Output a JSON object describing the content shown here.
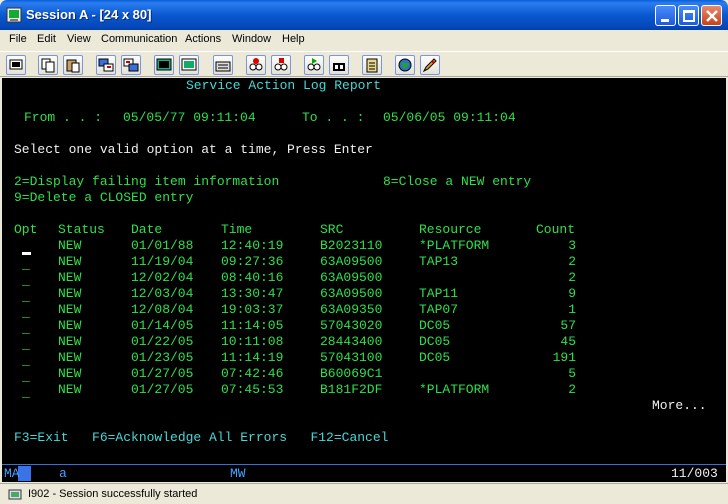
{
  "window": {
    "title": "Session A - [24 x 80]"
  },
  "menubar": [
    "File",
    "Edit",
    "View",
    "Communication",
    "Actions",
    "Window",
    "Help"
  ],
  "toolbar": {
    "buttons": [
      "print-screen-icon",
      "copy-icon",
      "paste-icon",
      "send-icon",
      "receive-icon",
      "display-icon",
      "keypad-icon",
      "macro-icon",
      "record-macro-icon",
      "stop-macro-icon",
      "play-macro-icon",
      "run-macro-icon",
      "clipboard-icon",
      "globe-icon",
      "edit-icon"
    ]
  },
  "screen": {
    "title": "Service Action Log Report",
    "from_label": "From . . :",
    "from_value": "05/05/77 09:11:04",
    "to_label": "To . . :",
    "to_value": "05/06/05 09:11:04",
    "instruction": "Select one valid option at a time, Press Enter",
    "option_2": "2=Display failing item information",
    "option_8": "8=Close a NEW entry",
    "option_9": "9=Delete a CLOSED entry",
    "columns": [
      "Opt",
      "Status",
      "Date",
      "Time",
      "SRC",
      "Resource",
      "Count"
    ],
    "rows": [
      {
        "opt": "_",
        "status": "NEW",
        "date": "01/01/88",
        "time": "12:40:19",
        "src": "B2023110",
        "resource": "*PLATFORM",
        "count": "3"
      },
      {
        "opt": "_",
        "status": "NEW",
        "date": "11/19/04",
        "time": "09:27:36",
        "src": "63A09500",
        "resource": "TAP13",
        "count": "2"
      },
      {
        "opt": "_",
        "status": "NEW",
        "date": "12/02/04",
        "time": "08:40:16",
        "src": "63A09500",
        "resource": "",
        "count": "2"
      },
      {
        "opt": "_",
        "status": "NEW",
        "date": "12/03/04",
        "time": "13:30:47",
        "src": "63A09500",
        "resource": "TAP11",
        "count": "9"
      },
      {
        "opt": "_",
        "status": "NEW",
        "date": "12/08/04",
        "time": "19:03:37",
        "src": "63A09350",
        "resource": "TAP07",
        "count": "1"
      },
      {
        "opt": "_",
        "status": "NEW",
        "date": "01/14/05",
        "time": "11:14:05",
        "src": "57043020",
        "resource": "DC05",
        "count": "57"
      },
      {
        "opt": "_",
        "status": "NEW",
        "date": "01/22/05",
        "time": "10:11:08",
        "src": "28443400",
        "resource": "DC05",
        "count": "45"
      },
      {
        "opt": "_",
        "status": "NEW",
        "date": "01/23/05",
        "time": "11:14:19",
        "src": "57043100",
        "resource": "DC05",
        "count": "191"
      },
      {
        "opt": "_",
        "status": "NEW",
        "date": "01/27/05",
        "time": "07:42:46",
        "src": "B60069C1",
        "resource": "",
        "count": "5"
      },
      {
        "opt": "_",
        "status": "NEW",
        "date": "01/27/05",
        "time": "07:45:53",
        "src": "B181F2DF",
        "resource": "*PLATFORM",
        "count": "2"
      }
    ],
    "more": "More...",
    "function_keys": "F3=Exit   F6=Acknowledge All Errors   F12=Cancel"
  },
  "oia": {
    "ma": "MA",
    "a": "a",
    "mw": "MW",
    "position": "11/003"
  },
  "statusbar": {
    "text": "I902 - Session successfully started"
  }
}
